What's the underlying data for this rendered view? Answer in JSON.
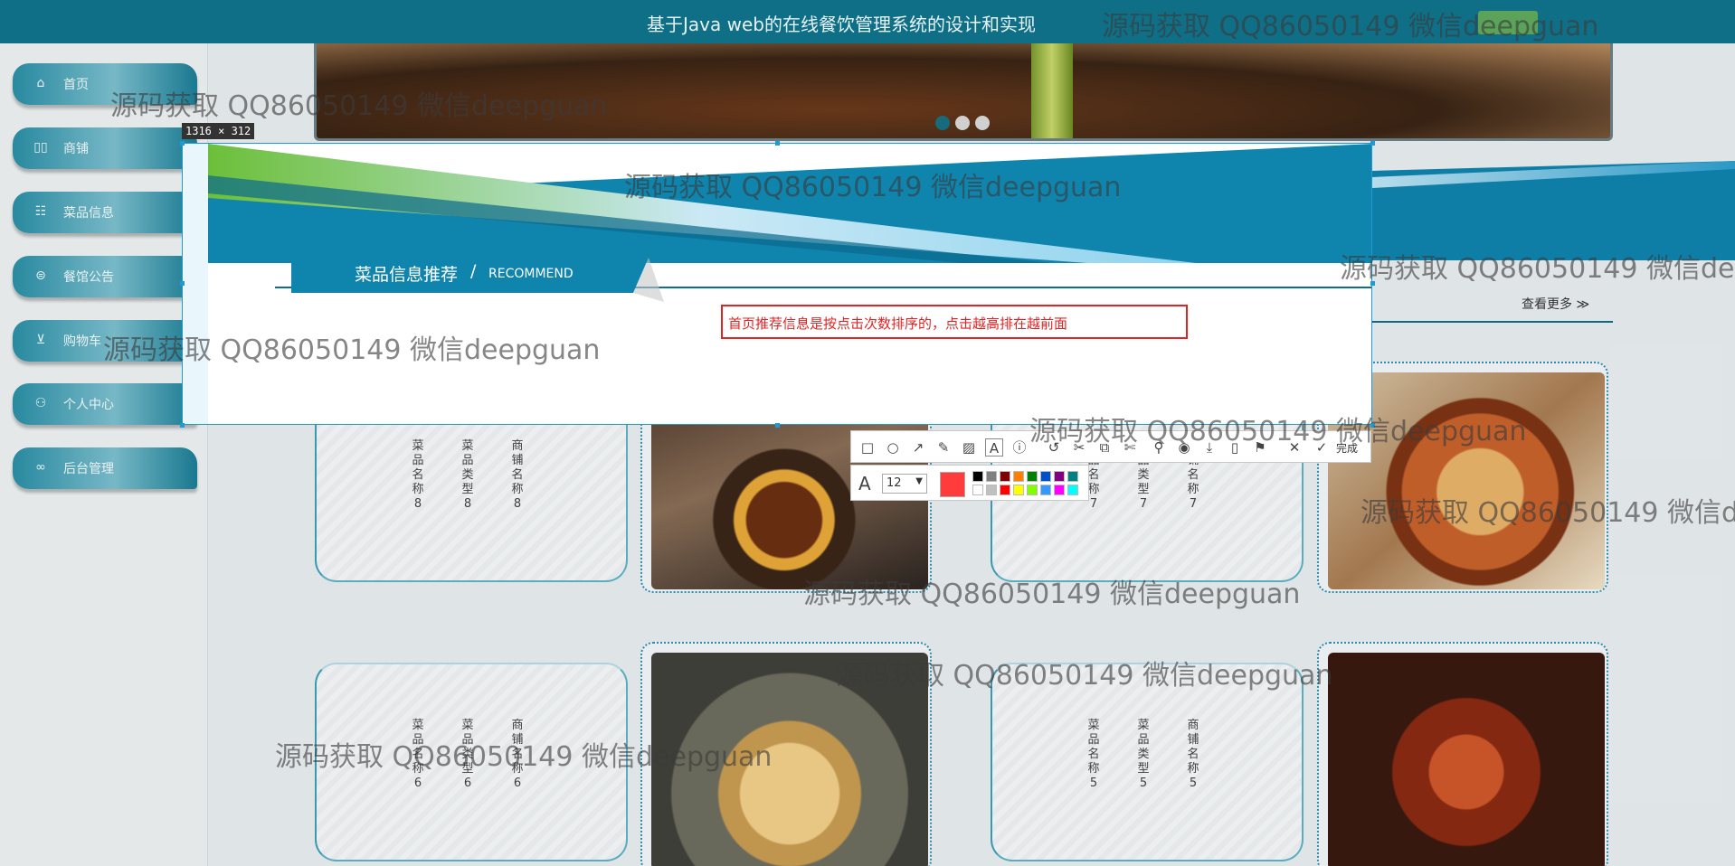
{
  "header": {
    "title": "基于Java web的在线餐饮管理系统的设计和实现"
  },
  "sidebar": {
    "items": [
      {
        "label": "首页",
        "icon": "home-icon"
      },
      {
        "label": "商铺",
        "icon": "shop-icon"
      },
      {
        "label": "菜品信息",
        "icon": "dish-icon"
      },
      {
        "label": "餐馆公告",
        "icon": "announcement-icon"
      },
      {
        "label": "购物车",
        "icon": "cart-icon"
      },
      {
        "label": "个人中心",
        "icon": "user-icon"
      },
      {
        "label": "后台管理",
        "icon": "link-icon"
      }
    ]
  },
  "section": {
    "title_cn": "菜品信息推荐",
    "separator": "/",
    "title_en": "RECOMMEND",
    "see_more": "查看更多 ≫",
    "annotation": "首页推荐信息是按点击次数排序的，点击越高排在越前面"
  },
  "cards": [
    {
      "cols": [
        "菜品名称8",
        "菜品类型8",
        "商铺名称8"
      ]
    },
    {
      "cols": [
        "菜品名称7",
        "菜品类型7",
        "商铺名称7"
      ]
    },
    {
      "cols": [
        "菜品名称6",
        "菜品类型6",
        "商铺名称6"
      ]
    },
    {
      "cols": [
        "菜品名称5",
        "菜品类型5",
        "商铺名称5"
      ]
    }
  ],
  "capture_tool": {
    "size_label": "1316 × 312",
    "font_size": "12",
    "done_label": "完成",
    "current_color": "#ff3b3b",
    "palette": [
      "#000000",
      "#808080",
      "#800000",
      "#ff8000",
      "#008000",
      "#0050c8",
      "#800080",
      "#008080",
      "#ffffff",
      "#c0c0c0",
      "#ff0000",
      "#ffff00",
      "#80ff00",
      "#3399ff",
      "#ff00ff",
      "#00ffff"
    ],
    "tools": [
      "rectangle-icon",
      "ellipse-icon",
      "arrow-icon",
      "pen-icon",
      "mosaic-icon",
      "text-icon",
      "number-icon",
      "undo-icon",
      "cut-icon",
      "copy-icon",
      "scissors-icon",
      "pin-icon",
      "record-icon",
      "download-icon",
      "save-icon",
      "bookmark-icon",
      "close-icon",
      "check-icon"
    ]
  },
  "watermark": "源码获取 QQ86050149 微信deepguan"
}
